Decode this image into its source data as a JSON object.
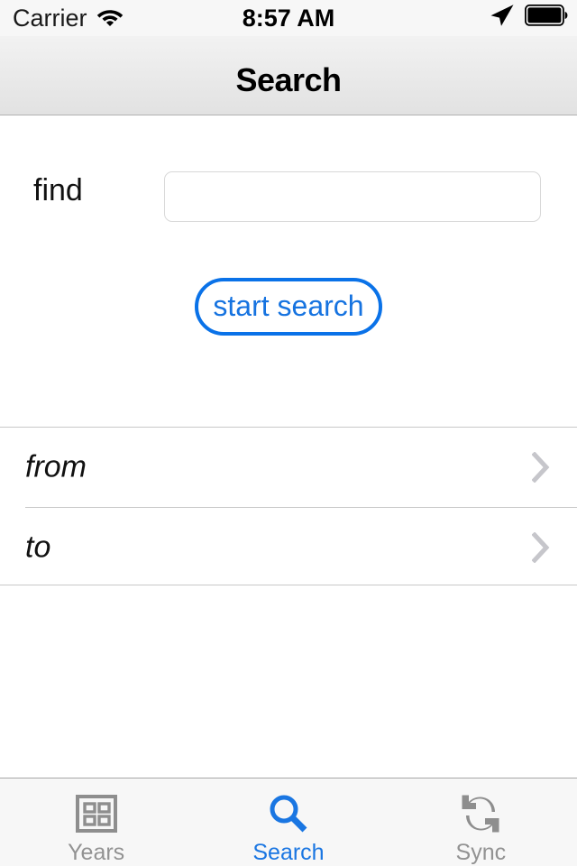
{
  "status_bar": {
    "carrier": "Carrier",
    "wifi_icon": "wifi-icon",
    "time": "8:57 AM",
    "location_icon": "location-arrow-icon",
    "battery_icon": "battery-full-icon"
  },
  "nav_bar": {
    "title": "Search"
  },
  "form": {
    "find_label": "find",
    "find_value": "",
    "find_placeholder": "",
    "start_search_label": "start search",
    "accent_color": "#0a72e8"
  },
  "rows": [
    {
      "label": "from",
      "accessory_icon": "chevron-right-icon"
    },
    {
      "label": "to",
      "accessory_icon": "chevron-right-icon"
    }
  ],
  "tab_bar": {
    "active_color": "#1a76e2",
    "inactive_color": "#929292",
    "items": [
      {
        "label": "Years",
        "icon": "grid-icon",
        "active": false
      },
      {
        "label": "Search",
        "icon": "magnifier-icon",
        "active": true
      },
      {
        "label": "Sync",
        "icon": "sync-icon",
        "active": false
      }
    ]
  }
}
